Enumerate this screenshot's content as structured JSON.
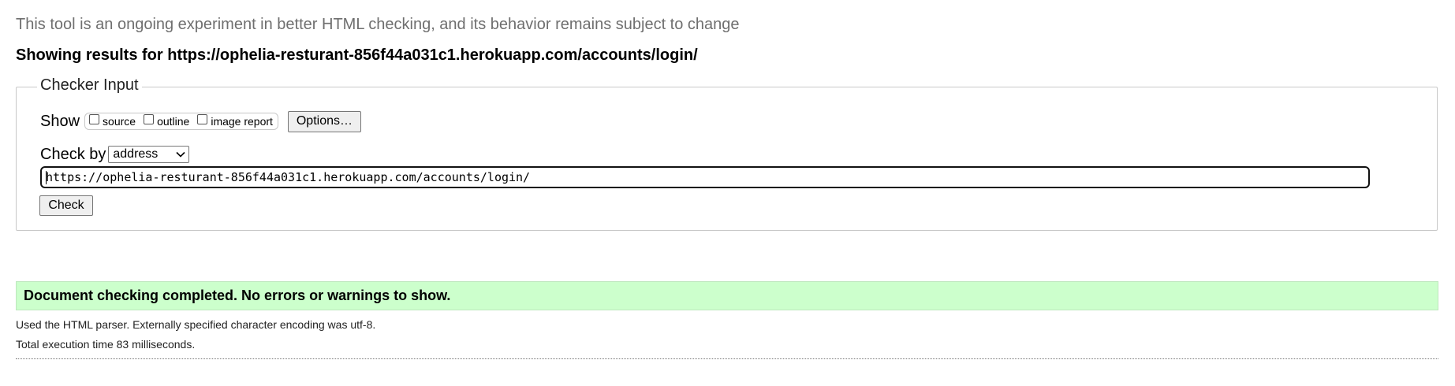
{
  "header": {
    "intro_text": "This tool is an ongoing experiment in better HTML checking, and its behavior remains subject to change",
    "results_prefix": "Showing results for ",
    "results_url": "https://ophelia-resturant-856f44a031c1.herokuapp.com/accounts/login/"
  },
  "checker_input": {
    "legend": "Checker Input",
    "show_label": "Show",
    "show_options": [
      {
        "label": "source",
        "checked": false
      },
      {
        "label": "outline",
        "checked": false
      },
      {
        "label": "image report",
        "checked": false
      }
    ],
    "options_button": "Options…",
    "check_by_label": "Check by",
    "check_by_value": "address",
    "url_value": "https://ophelia-resturant-856f44a031c1.herokuapp.com/accounts/login/",
    "check_button": "Check"
  },
  "results": {
    "success_message": "Document checking completed. No errors or warnings to show.",
    "success_color": "#ccffcc",
    "parser_info": "Used the HTML parser. Externally specified character encoding was utf-8.",
    "execution_time": "Total execution time 83 milliseconds."
  }
}
